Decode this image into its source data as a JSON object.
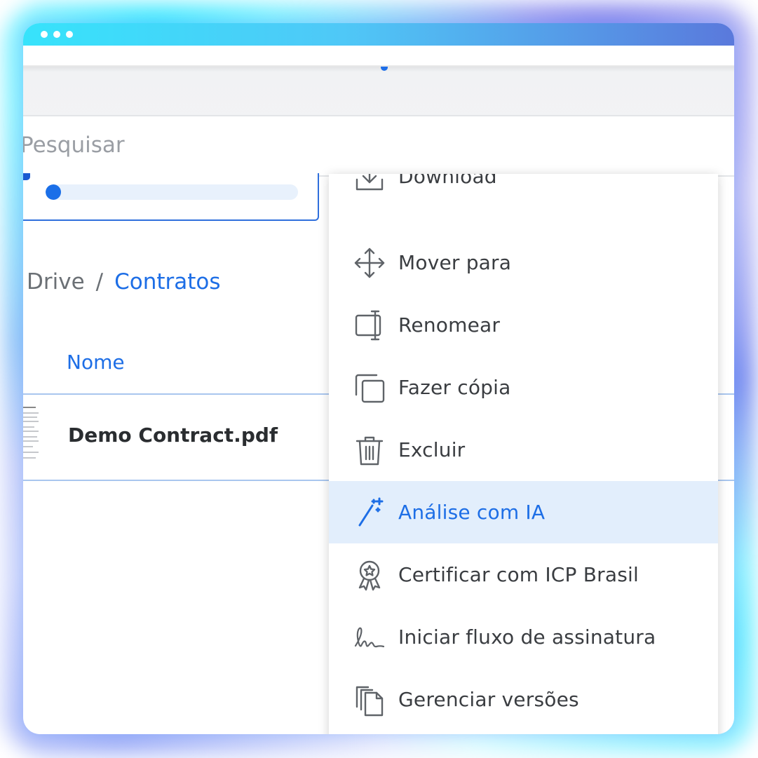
{
  "search": {
    "placeholder": "Pesquisar"
  },
  "storage": {
    "used_fraction": 0.06
  },
  "breadcrumb": {
    "root": "Drive",
    "separator": "/",
    "current": "Contratos"
  },
  "table": {
    "header_name": "Nome",
    "rows": [
      {
        "name": "Demo Contract.pdf"
      }
    ]
  },
  "context_menu": {
    "items": [
      {
        "label": "Download",
        "icon": "download-icon"
      },
      {
        "label": "Mover para",
        "icon": "move-icon"
      },
      {
        "label": "Renomear",
        "icon": "rename-icon"
      },
      {
        "label": "Fazer cópia",
        "icon": "copy-icon"
      },
      {
        "label": "Excluir",
        "icon": "trash-icon"
      },
      {
        "label": "Análise com IA",
        "icon": "magic-wand-icon",
        "active": true
      },
      {
        "label": "Certificar com ICP Brasil",
        "icon": "certificate-badge-icon"
      },
      {
        "label": "Iniciar fluxo de assinatura",
        "icon": "signature-icon"
      },
      {
        "label": "Gerenciar versões",
        "icon": "versions-icon"
      },
      {
        "label": "",
        "icon": "archive-icon"
      }
    ]
  },
  "colors": {
    "accent": "#1d6ee6",
    "active_item_bg": "#e2eefc",
    "titlebar_start": "#37e3fb",
    "titlebar_end": "#5a79dc"
  }
}
